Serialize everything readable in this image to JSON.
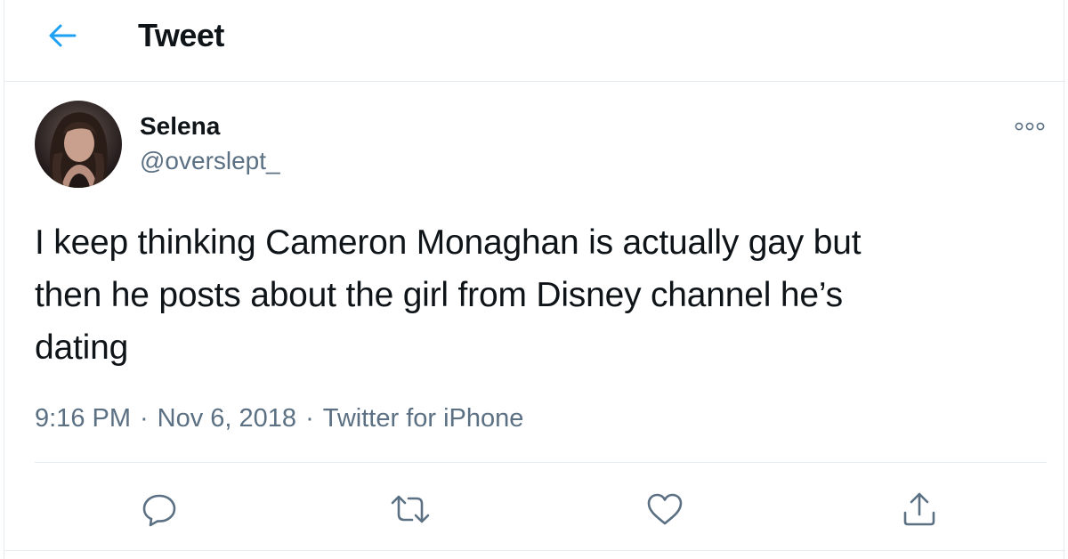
{
  "header": {
    "title": "Tweet",
    "back_icon": "arrow-left-icon"
  },
  "tweet": {
    "display_name": "Selena",
    "handle": "@overslept_",
    "text": "I keep thinking Cameron Monaghan is actually gay but\nthen he posts about the girl from Disney channel he’s\ndating",
    "time": "9:16 PM",
    "separator": "·",
    "date": "Nov 6, 2018",
    "source": "Twitter for iPhone",
    "more_icon": "more-horizontal-icon"
  },
  "actions": [
    {
      "name": "reply",
      "icon": "reply-icon"
    },
    {
      "name": "retweet",
      "icon": "retweet-icon"
    },
    {
      "name": "like",
      "icon": "heart-icon"
    },
    {
      "name": "share",
      "icon": "share-icon"
    }
  ],
  "colors": {
    "accent": "#1da1f2",
    "text_primary": "#0f1419",
    "text_secondary": "#5b7083",
    "border": "#e6ecf0"
  }
}
